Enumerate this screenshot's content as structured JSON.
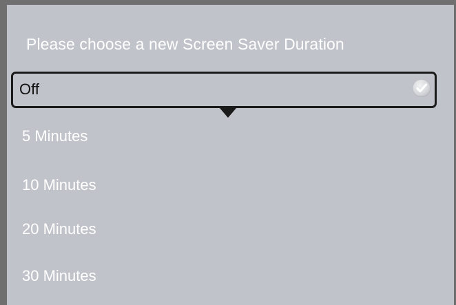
{
  "dialog": {
    "title": "Please choose a new Screen Saver Duration",
    "selected_option": "Off",
    "options": [
      {
        "label": "Off",
        "selected": true
      },
      {
        "label": "5 Minutes",
        "selected": false
      },
      {
        "label": "10 Minutes",
        "selected": false
      },
      {
        "label": "20 Minutes",
        "selected": false
      },
      {
        "label": "30 Minutes",
        "selected": false
      }
    ]
  },
  "colors": {
    "background": "#c0c3c9",
    "frame": "#6f6f6f",
    "highlight_border": "#1a1a1a",
    "option_text": "#ffffff",
    "selected_text": "#111111"
  },
  "icons": {
    "selected_marker": "checkmark-icon",
    "focus_pointer": "down-triangle-icon"
  }
}
